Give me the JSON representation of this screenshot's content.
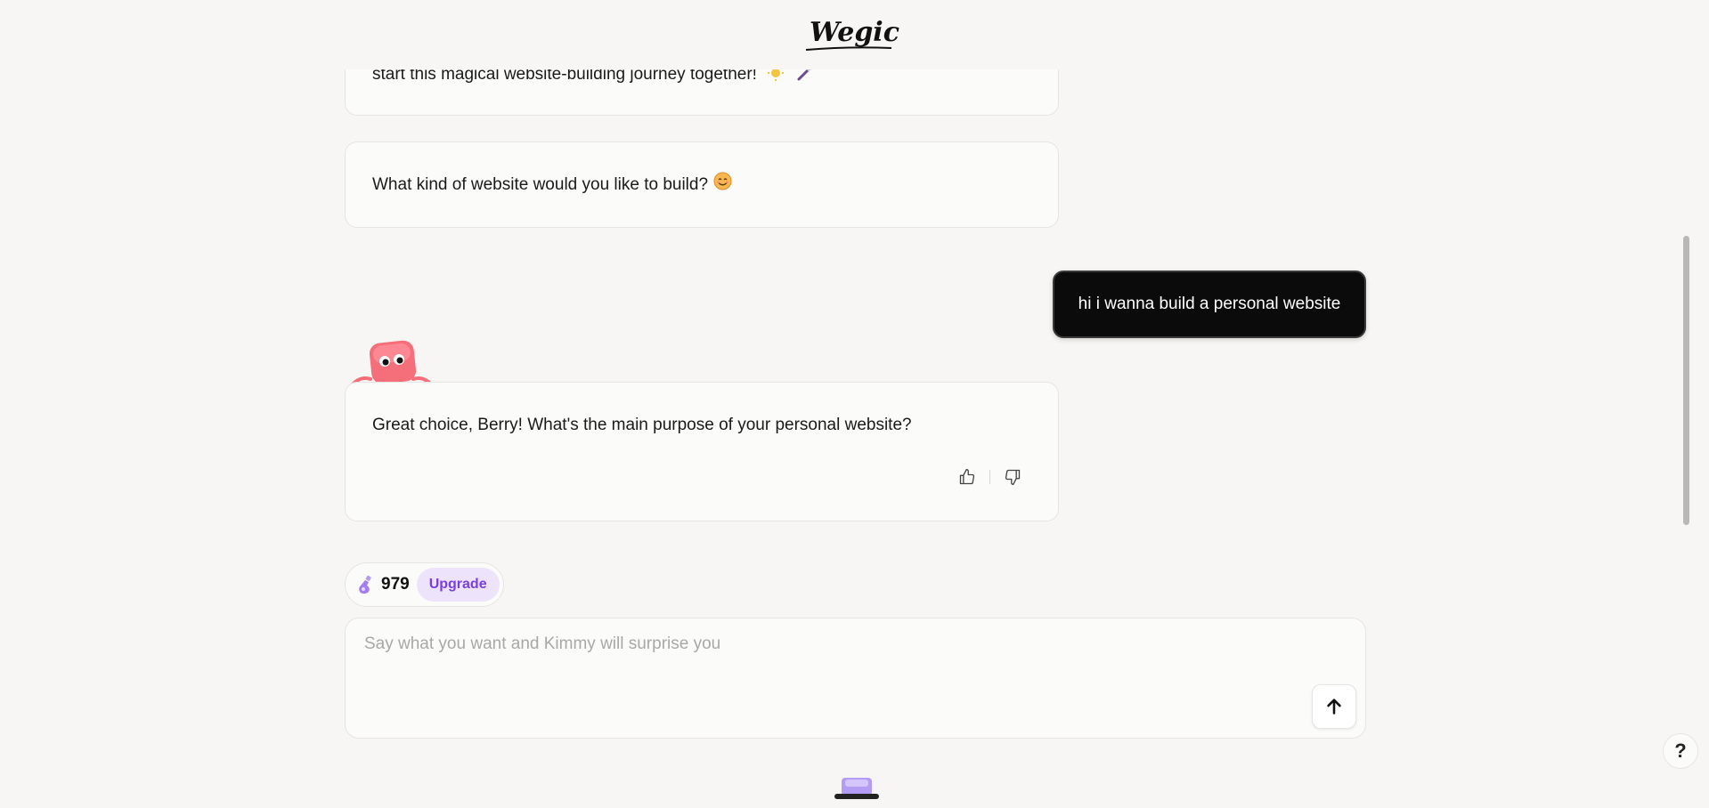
{
  "header": {
    "logo_text": "Wegic"
  },
  "messages": [
    {
      "role": "assistant",
      "text": "start this magical website-building journey together!",
      "icons": [
        "sun-icon",
        "magic-wand-icon"
      ]
    },
    {
      "role": "assistant",
      "text": "What kind of website would you like to build?",
      "icons": [
        "smile-icon"
      ]
    },
    {
      "role": "user",
      "text": "hi i wanna build a personal website"
    },
    {
      "role": "assistant",
      "text": "Great choice, Berry! What's the main purpose of your personal website?"
    }
  ],
  "credits": {
    "count": "979",
    "upgrade_label": "Upgrade"
  },
  "input": {
    "placeholder": "Say what you want and Kimmy will surprise you",
    "value": ""
  },
  "help": {
    "label": "?"
  },
  "colors": {
    "background": "#f7f6f4",
    "user_bubble": "#0b0b0b",
    "upgrade_bg": "#ede4fb",
    "upgrade_text": "#7a3fe0",
    "mascot": "#f56f7a"
  }
}
